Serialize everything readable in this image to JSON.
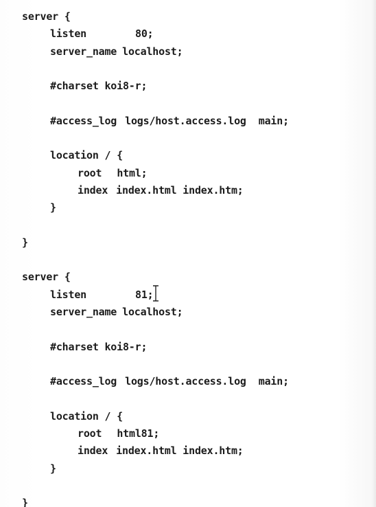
{
  "editor": {
    "lines": [
      {
        "indent": 0,
        "parts": [
          "server {"
        ]
      },
      {
        "indent": 1,
        "parts": [
          "listen",
          "80;"
        ]
      },
      {
        "indent": 1,
        "parts": [
          "server_name",
          "localhost;"
        ]
      },
      {
        "indent": 0,
        "parts": []
      },
      {
        "indent": 1,
        "parts": [
          "#charset koi8-r;"
        ]
      },
      {
        "indent": 0,
        "parts": []
      },
      {
        "indent": 1,
        "parts": [
          "#access_log",
          "logs/host.access.log",
          "main;"
        ]
      },
      {
        "indent": 0,
        "parts": []
      },
      {
        "indent": 1,
        "parts": [
          "location / {"
        ]
      },
      {
        "indent": 2,
        "parts": [
          "root",
          "html;"
        ]
      },
      {
        "indent": 2,
        "parts": [
          "index",
          "index.html index.htm;"
        ]
      },
      {
        "indent": 1,
        "parts": [
          "}"
        ]
      },
      {
        "indent": 0,
        "parts": []
      },
      {
        "indent": 0,
        "parts": [
          "}"
        ]
      },
      {
        "indent": 0,
        "parts": []
      },
      {
        "indent": 0,
        "parts": [
          "server {"
        ]
      },
      {
        "indent": 1,
        "parts": [
          "listen",
          "81;"
        ]
      },
      {
        "indent": 1,
        "parts": [
          "server_name",
          "localhost;"
        ]
      },
      {
        "indent": 0,
        "parts": []
      },
      {
        "indent": 1,
        "parts": [
          "#charset koi8-r;"
        ]
      },
      {
        "indent": 0,
        "parts": []
      },
      {
        "indent": 1,
        "parts": [
          "#access_log",
          "logs/host.access.log",
          "main;"
        ]
      },
      {
        "indent": 0,
        "parts": []
      },
      {
        "indent": 1,
        "parts": [
          "location / {"
        ]
      },
      {
        "indent": 2,
        "parts": [
          "root",
          "html81;"
        ]
      },
      {
        "indent": 2,
        "parts": [
          "index",
          "index.html index.htm;"
        ]
      },
      {
        "indent": 1,
        "parts": [
          "}"
        ]
      },
      {
        "indent": 0,
        "parts": []
      },
      {
        "indent": 0,
        "parts": [
          "}"
        ]
      }
    ]
  },
  "colors": {
    "text": "#1b1b1b",
    "background": "#ffffff"
  },
  "icons": {
    "cursor": "text-cursor-icon"
  }
}
